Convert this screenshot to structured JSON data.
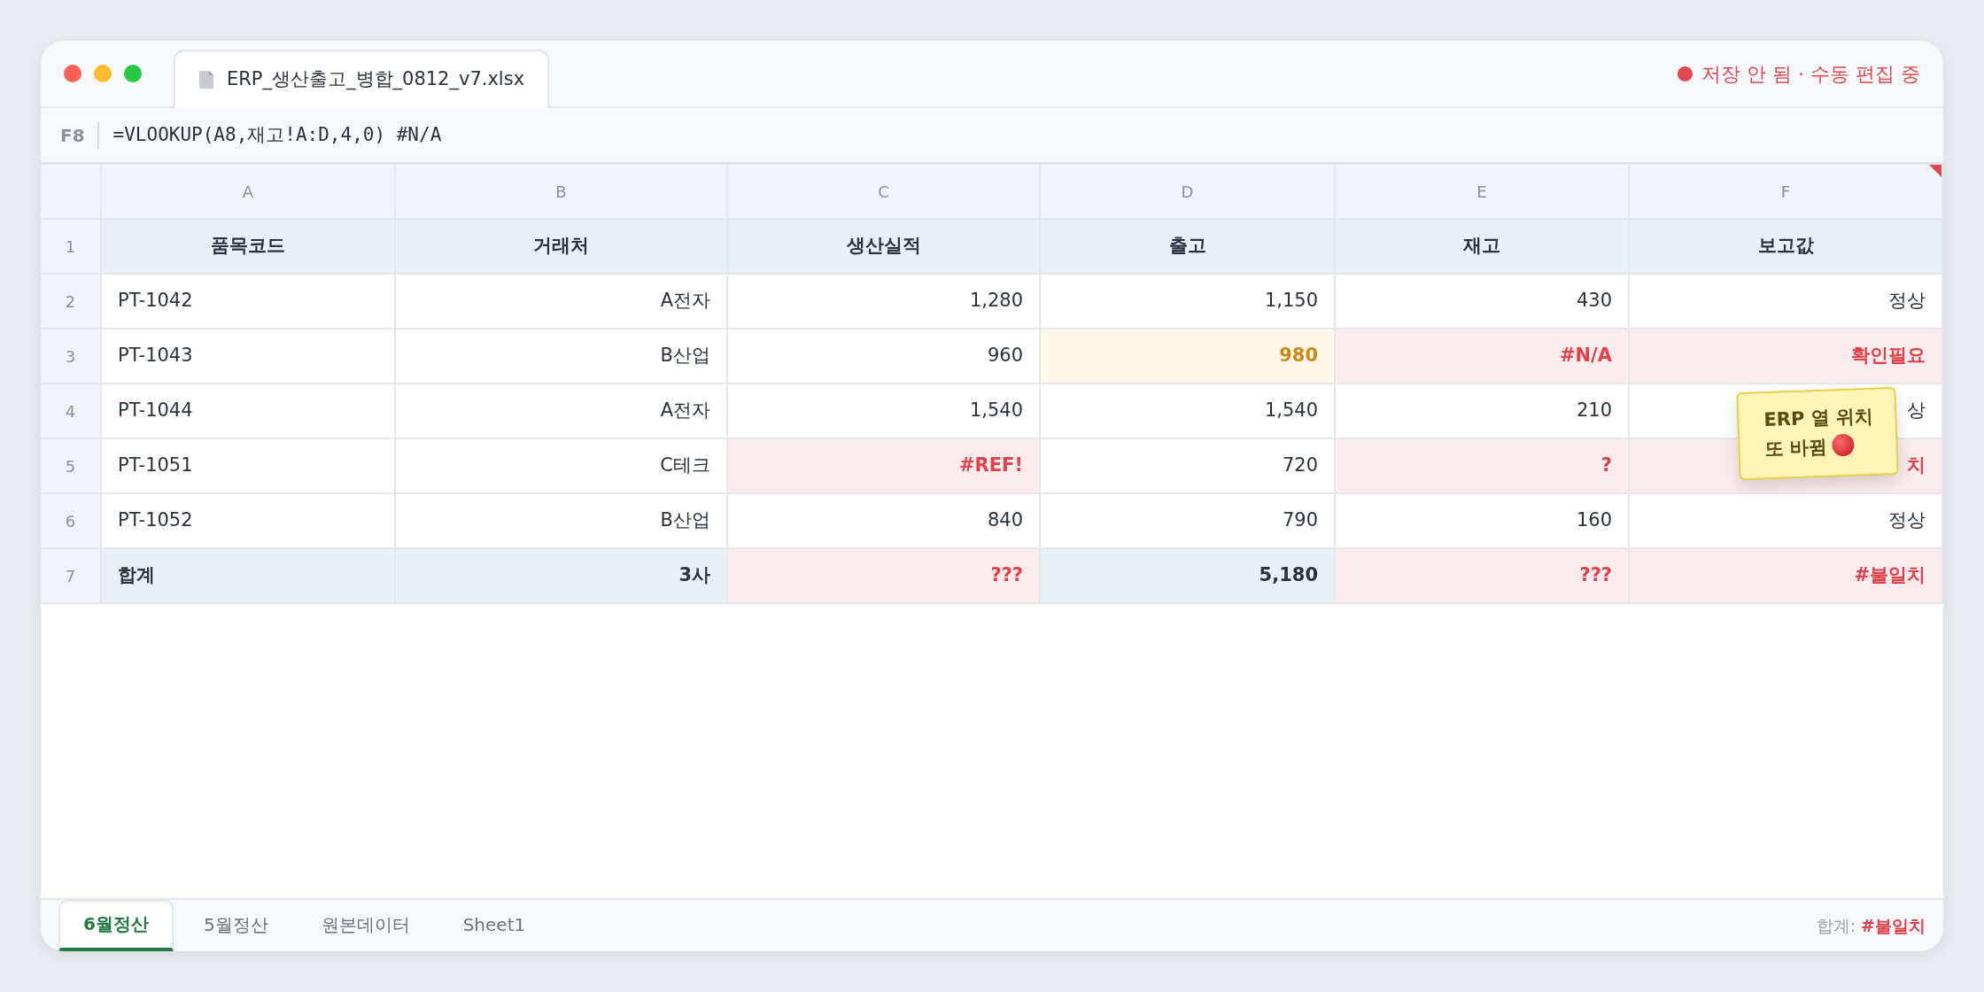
{
  "window": {
    "file_tab": "ERP_생산출고_병합_0812_v7.xlsx",
    "status": "저장 안 됨 · 수동 편집 중"
  },
  "formula_bar": {
    "cell_ref": "F8",
    "formula": "=VLOOKUP(A8,재고!A:D,4,0) #N/A"
  },
  "columns": [
    {
      "label": "A",
      "comment": false
    },
    {
      "label": "B",
      "comment": false
    },
    {
      "label": "C",
      "comment": false
    },
    {
      "label": "D",
      "comment": false
    },
    {
      "label": "E",
      "comment": false
    },
    {
      "label": "F",
      "comment": true
    }
  ],
  "rows": [
    {
      "number": "1",
      "kind": "header",
      "cells": [
        {
          "text": "품목코드",
          "error": false,
          "warning": false
        },
        {
          "text": "거래처",
          "error": false,
          "warning": false
        },
        {
          "text": "생산실적",
          "error": false,
          "warning": false
        },
        {
          "text": "출고",
          "error": false,
          "warning": false
        },
        {
          "text": "재고",
          "error": false,
          "warning": false
        },
        {
          "text": "보고값",
          "error": false,
          "warning": false
        }
      ]
    },
    {
      "number": "2",
      "kind": "data",
      "cells": [
        {
          "text": "PT-1042",
          "error": false,
          "warning": false
        },
        {
          "text": "A전자",
          "error": false,
          "warning": false
        },
        {
          "text": "1,280",
          "error": false,
          "warning": false
        },
        {
          "text": "1,150",
          "error": false,
          "warning": false
        },
        {
          "text": "430",
          "error": false,
          "warning": false
        },
        {
          "text": "정상",
          "error": false,
          "warning": false
        }
      ]
    },
    {
      "number": "3",
      "kind": "data",
      "cells": [
        {
          "text": "PT-1043",
          "error": false,
          "warning": false
        },
        {
          "text": "B산업",
          "error": false,
          "warning": false
        },
        {
          "text": "960",
          "error": false,
          "warning": false
        },
        {
          "text": "980",
          "error": false,
          "warning": true
        },
        {
          "text": "#N/A",
          "error": true,
          "warning": false
        },
        {
          "text": "확인필요",
          "error": true,
          "warning": false
        }
      ]
    },
    {
      "number": "4",
      "kind": "data",
      "cells": [
        {
          "text": "PT-1044",
          "error": false,
          "warning": false
        },
        {
          "text": "A전자",
          "error": false,
          "warning": false
        },
        {
          "text": "1,540",
          "error": false,
          "warning": false
        },
        {
          "text": "1,540",
          "error": false,
          "warning": false
        },
        {
          "text": "210",
          "error": false,
          "warning": false
        },
        {
          "text": "상",
          "error": false,
          "warning": false
        }
      ]
    },
    {
      "number": "5",
      "kind": "data",
      "cells": [
        {
          "text": "PT-1051",
          "error": false,
          "warning": false
        },
        {
          "text": "C테크",
          "error": false,
          "warning": false
        },
        {
          "text": "#REF!",
          "error": true,
          "warning": false
        },
        {
          "text": "720",
          "error": false,
          "warning": false
        },
        {
          "text": "?",
          "error": true,
          "warning": false
        },
        {
          "text": "치",
          "error": true,
          "warning": false
        }
      ]
    },
    {
      "number": "6",
      "kind": "data",
      "cells": [
        {
          "text": "PT-1052",
          "error": false,
          "warning": false
        },
        {
          "text": "B산업",
          "error": false,
          "warning": false
        },
        {
          "text": "840",
          "error": false,
          "warning": false
        },
        {
          "text": "790",
          "error": false,
          "warning": false
        },
        {
          "text": "160",
          "error": false,
          "warning": false
        },
        {
          "text": "정상",
          "error": false,
          "warning": false
        }
      ]
    },
    {
      "number": "7",
      "kind": "total",
      "cells": [
        {
          "text": "합계",
          "error": false,
          "warning": false
        },
        {
          "text": "3사",
          "error": false,
          "warning": false
        },
        {
          "text": "???",
          "error": true,
          "warning": false
        },
        {
          "text": "5,180",
          "error": false,
          "warning": false
        },
        {
          "text": "???",
          "error": true,
          "warning": false
        },
        {
          "text": "#불일치",
          "error": true,
          "warning": false
        }
      ]
    }
  ],
  "note": {
    "lines": [
      "ERP 열 위치",
      "또 바뀜"
    ]
  },
  "sheet_tabs": [
    {
      "label": "6월정산",
      "selected": true
    },
    {
      "label": "5월정산",
      "selected": false
    },
    {
      "label": "원본데이터",
      "selected": false
    },
    {
      "label": "Sheet1",
      "selected": false
    }
  ],
  "footer": {
    "label": "합계:",
    "value": "#불일치"
  }
}
